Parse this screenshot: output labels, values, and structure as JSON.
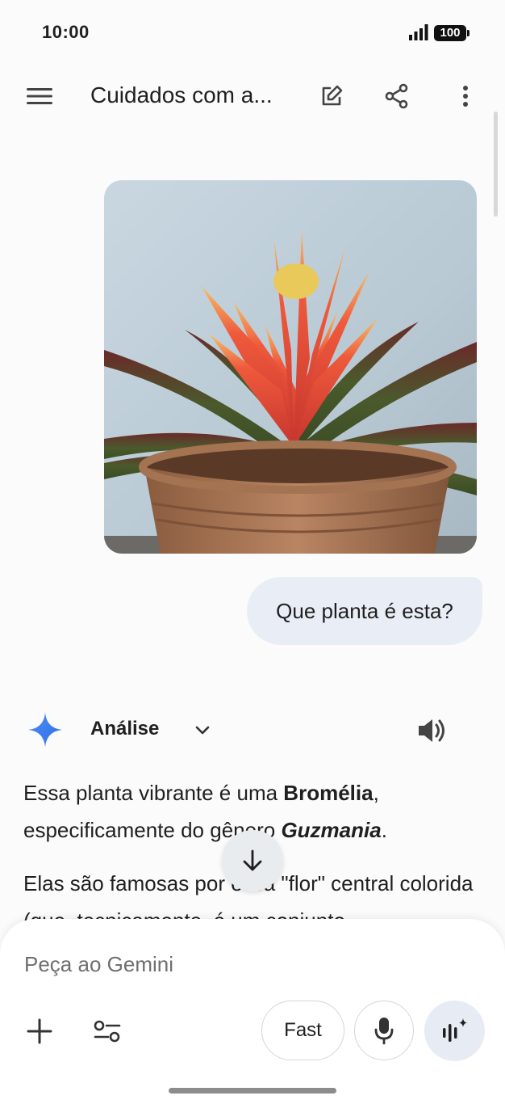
{
  "status_bar": {
    "time": "10:00",
    "battery": "100"
  },
  "app_bar": {
    "title": "Cuidados com a..."
  },
  "conversation": {
    "user_image_alt": "Bromeliad plant in terracotta pot",
    "user_prompt": "Que planta é esta?",
    "model_mode": "Análise",
    "response": {
      "p1_pre": "Essa planta vibrante é uma ",
      "p1_bold": "Bromélia",
      "p1_mid": ", especificamente do gênero ",
      "p1_italic": "Guzmania",
      "p1_end": ".",
      "p2": "Elas são famosas por essa \"flor\" central colorida (que, tecnicamente, é um conjunto"
    }
  },
  "input": {
    "placeholder": "Peça ao Gemini",
    "fast_label": "Fast"
  },
  "icons": {
    "menu": "menu-icon",
    "edit": "edit-icon",
    "share": "share-icon",
    "more": "more-vert-icon",
    "gemini": "gemini-star-icon",
    "chevron": "chevron-down-icon",
    "speaker": "speaker-icon",
    "scroll_down": "arrow-down-icon",
    "plus": "plus-icon",
    "tools": "tools-icon",
    "mic": "mic-icon",
    "live": "live-icon"
  },
  "colors": {
    "bubble": "#e9eef6",
    "gemini_blue": "#4285f4",
    "background": "#fbfbfb"
  }
}
